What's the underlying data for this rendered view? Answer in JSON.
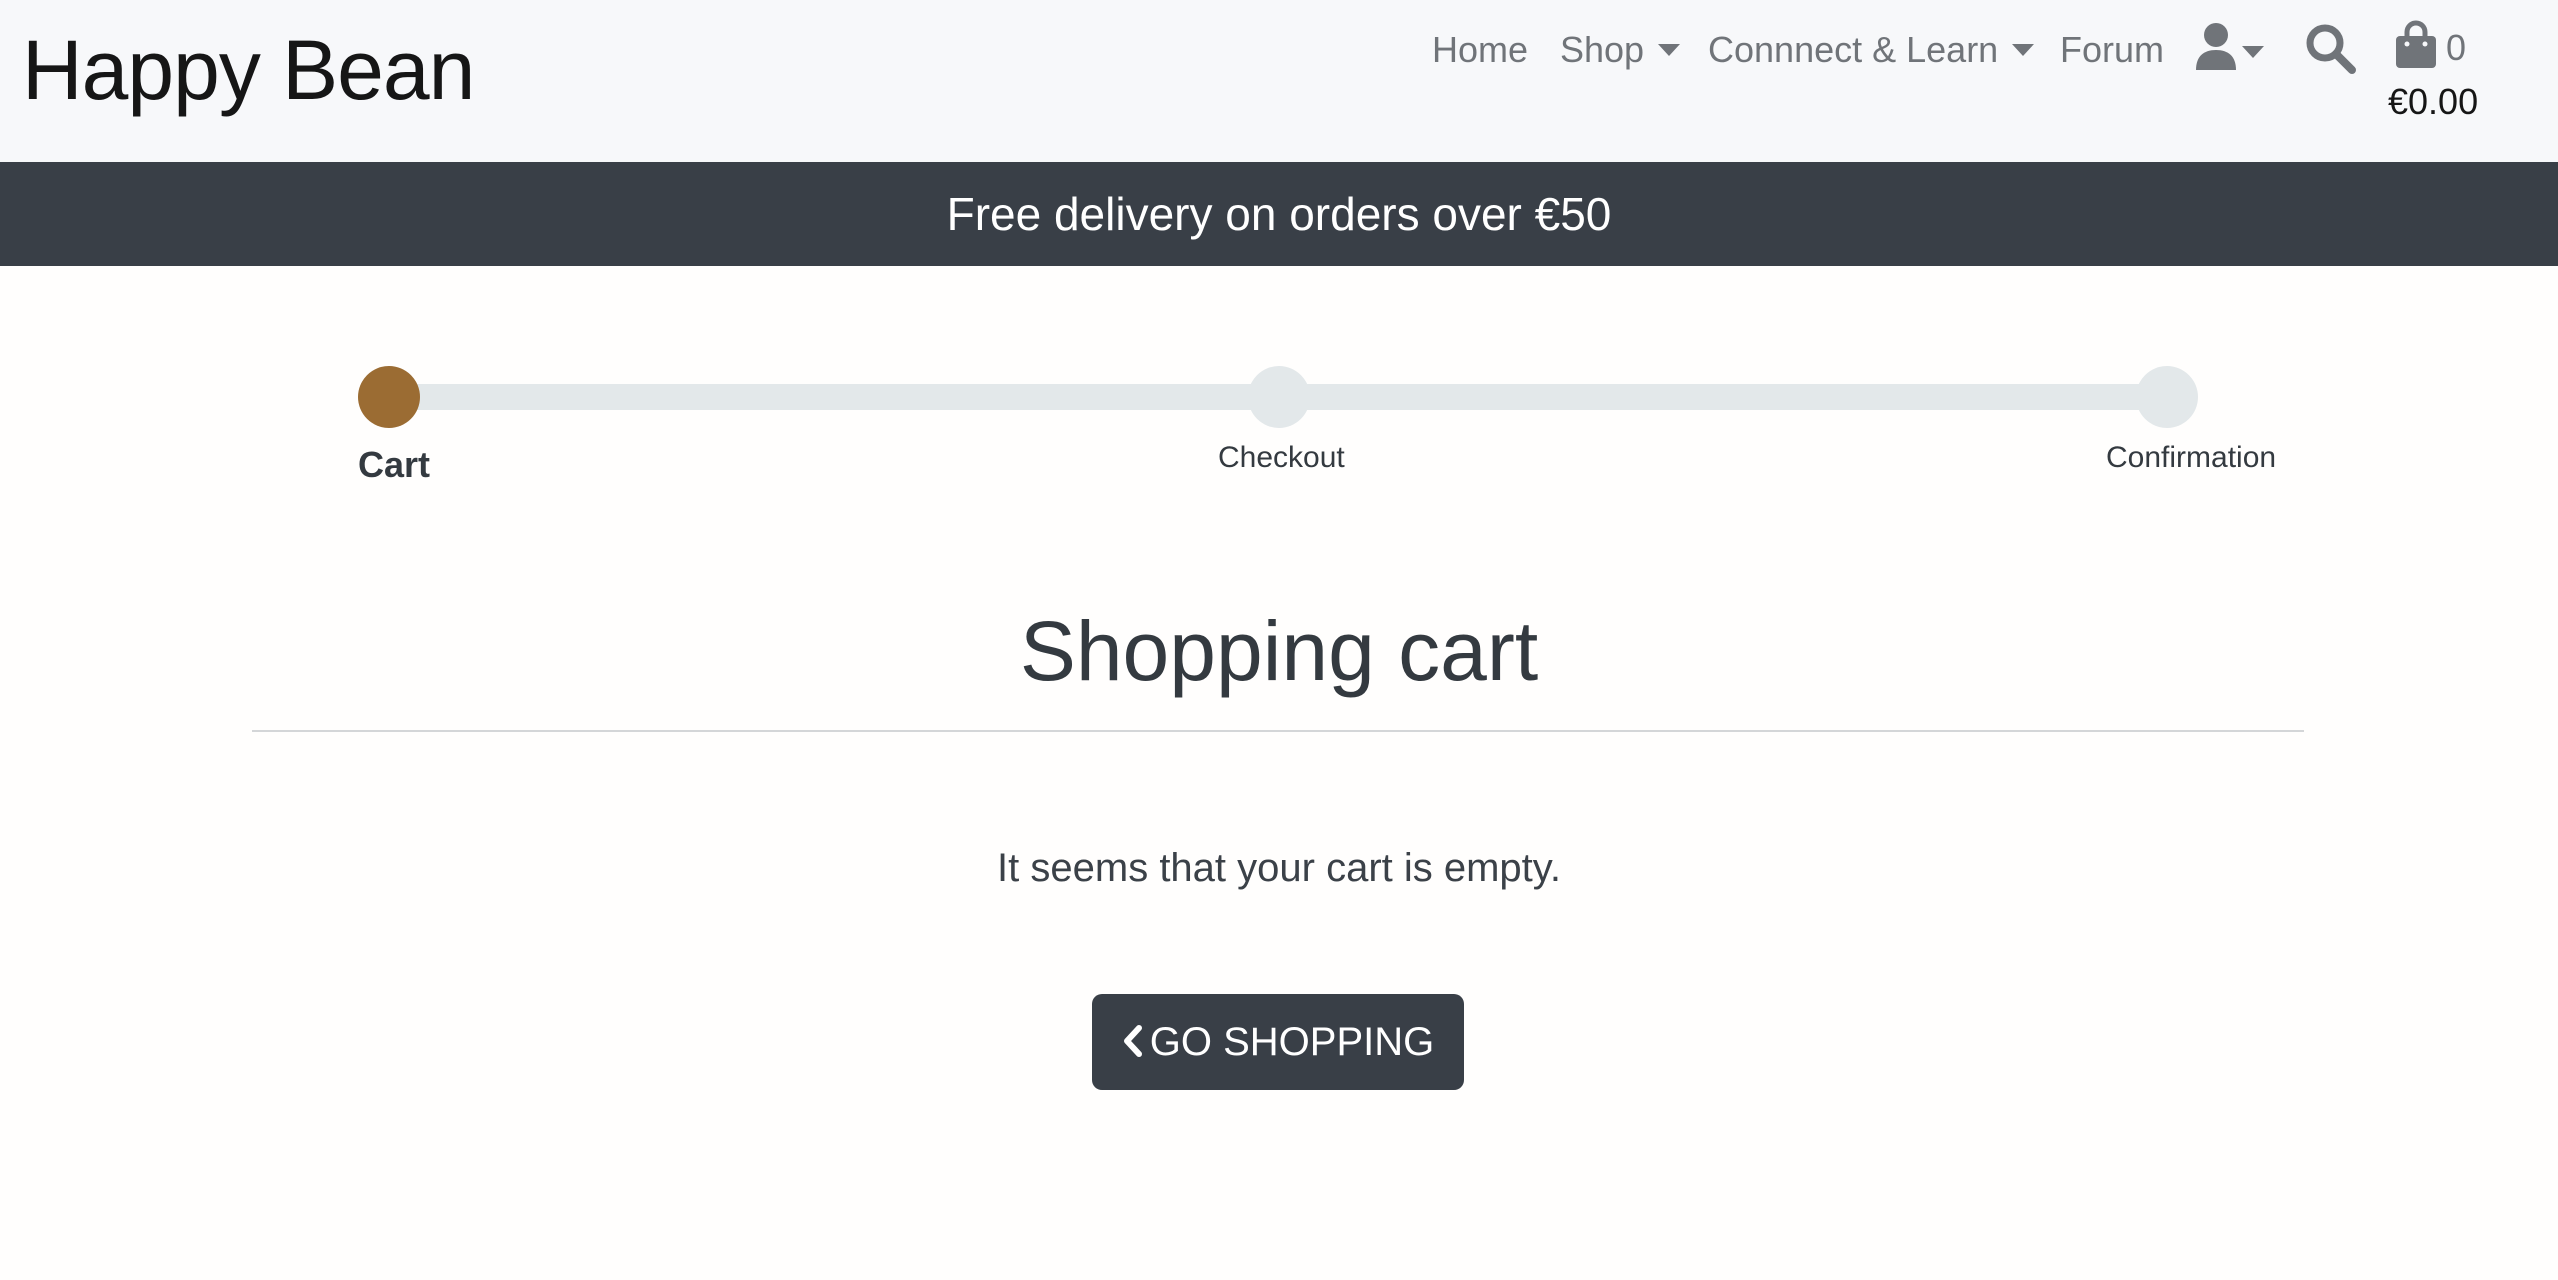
{
  "brand": {
    "name": "Happy Bean"
  },
  "nav": {
    "home": "Home",
    "shop": "Shop",
    "learn": "Connnect & Learn",
    "forum": "Forum",
    "user_icon": "user-icon",
    "search_icon": "search-icon",
    "cart_icon": "shopping-bag-icon",
    "cart_count": "0",
    "cart_total": "€0.00"
  },
  "banner": {
    "text": "Free delivery on orders over €50"
  },
  "stepper": {
    "steps": [
      {
        "label": "Cart",
        "active": true
      },
      {
        "label": "Checkout",
        "active": false
      },
      {
        "label": "Confirmation",
        "active": false
      }
    ],
    "active_color": "#9b6c33",
    "inactive_color": "#e3e8ea"
  },
  "main": {
    "title": "Shopping cart",
    "empty_message": "It seems that your cart is empty.",
    "button_label": "GO SHOPPING",
    "button_icon": "chevron-left-icon"
  },
  "colors": {
    "header_bg": "#f7f8fa",
    "banner_bg": "#393f47",
    "button_bg": "#393f47"
  }
}
